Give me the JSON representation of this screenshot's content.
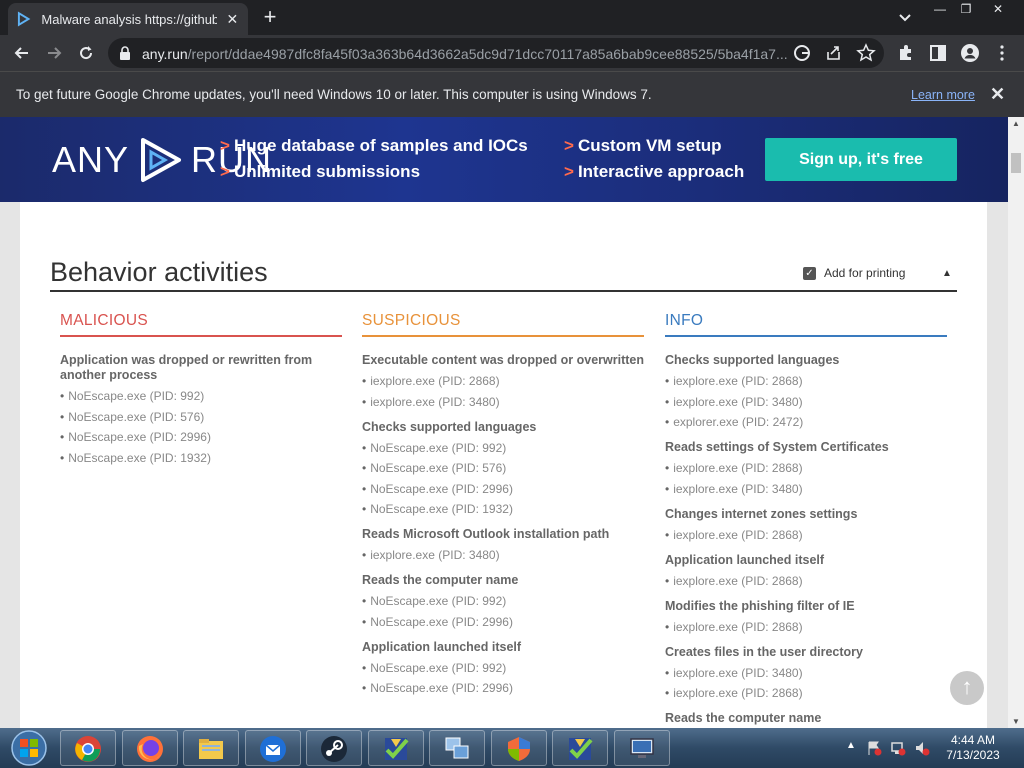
{
  "browser": {
    "tab_title": "Malware analysis https://github.c",
    "tab_close": "✕",
    "new_tab": "+",
    "url_host": "any.run",
    "url_path": "/report/ddae4987dfc8fa45f03a363b64d3662a5dc9d71dcc70117a85a6bab9cee88525/5ba4f1a7...",
    "window_controls": {
      "minimize": "—",
      "restore": "❐",
      "close": "✕"
    }
  },
  "infobar": {
    "message": "To get future Google Chrome updates, you'll need Windows 10 or later. This computer is using Windows 7.",
    "learn_more": "Learn more",
    "close": "✕"
  },
  "banner": {
    "logo_left": "ANY",
    "logo_right": "RUN",
    "features": [
      "Huge database of samples and IOCs",
      "Unlimited submissions",
      "Custom VM setup",
      "Interactive approach"
    ],
    "arrow": ">",
    "signup": "Sign up, it's free",
    "accent": "#1abcae"
  },
  "section": {
    "title": "Behavior activities",
    "add_for_printing": "Add for printing",
    "checkbox_mark": "✓",
    "collapse_arrow": "▲"
  },
  "columns": [
    {
      "heading": "MALICIOUS",
      "color": "#d9534f",
      "groups": [
        {
          "title": "Application was dropped or rewritten from another process",
          "items": [
            "NoEscape.exe (PID: 992)",
            "NoEscape.exe (PID: 576)",
            "NoEscape.exe (PID: 2996)",
            "NoEscape.exe (PID: 1932)"
          ]
        }
      ]
    },
    {
      "heading": "SUSPICIOUS",
      "color": "#e8923a",
      "groups": [
        {
          "title": "Executable content was dropped or overwritten",
          "items": [
            "iexplore.exe (PID: 2868)",
            "iexplore.exe (PID: 3480)"
          ]
        },
        {
          "title": "Checks supported languages",
          "items": [
            "NoEscape.exe (PID: 992)",
            "NoEscape.exe (PID: 576)",
            "NoEscape.exe (PID: 2996)",
            "NoEscape.exe (PID: 1932)"
          ]
        },
        {
          "title": "Reads Microsoft Outlook installation path",
          "items": [
            "iexplore.exe (PID: 3480)"
          ]
        },
        {
          "title": "Reads the computer name",
          "items": [
            "NoEscape.exe (PID: 992)",
            "NoEscape.exe (PID: 2996)"
          ]
        },
        {
          "title": "Application launched itself",
          "items": [
            "NoEscape.exe (PID: 992)",
            "NoEscape.exe (PID: 2996)"
          ]
        }
      ]
    },
    {
      "heading": "INFO",
      "color": "#3a7bbf",
      "groups": [
        {
          "title": "Checks supported languages",
          "items": [
            "iexplore.exe (PID: 2868)",
            "iexplore.exe (PID: 3480)",
            "explorer.exe (PID: 2472)"
          ]
        },
        {
          "title": "Reads settings of System Certificates",
          "items": [
            "iexplore.exe (PID: 2868)",
            "iexplore.exe (PID: 3480)"
          ]
        },
        {
          "title": "Changes internet zones settings",
          "items": [
            "iexplore.exe (PID: 2868)"
          ]
        },
        {
          "title": "Application launched itself",
          "items": [
            "iexplore.exe (PID: 2868)"
          ]
        },
        {
          "title": "Modifies the phishing filter of IE",
          "items": [
            "iexplore.exe (PID: 2868)"
          ]
        },
        {
          "title": "Creates files in the user directory",
          "items": [
            "iexplore.exe (PID: 3480)",
            "iexplore.exe (PID: 2868)"
          ]
        },
        {
          "title": "Reads the computer name",
          "items": []
        }
      ]
    }
  ],
  "scroll_top": "↑",
  "taskbar": {
    "apps": [
      "chrome-icon",
      "firefox-icon",
      "file-explorer-icon",
      "thunderbird-icon",
      "steam-icon",
      "checklist-app-icon",
      "network-app-icon",
      "shield-app-icon",
      "checklist-app-icon",
      "monitor-app-icon"
    ],
    "time": "4:44 AM",
    "date": "7/13/2023"
  }
}
